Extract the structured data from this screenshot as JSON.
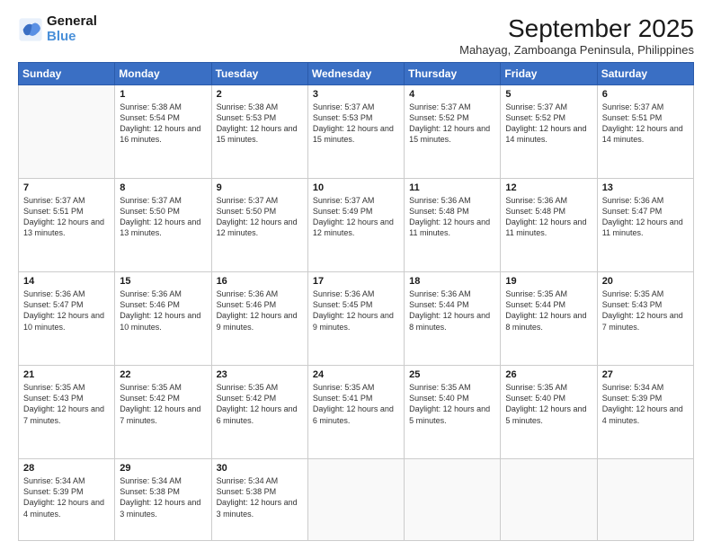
{
  "logo": {
    "line1": "General",
    "line2": "Blue"
  },
  "title": "September 2025",
  "location": "Mahayag, Zamboanga Peninsula, Philippines",
  "days": [
    "Sunday",
    "Monday",
    "Tuesday",
    "Wednesday",
    "Thursday",
    "Friday",
    "Saturday"
  ],
  "weeks": [
    [
      {
        "day": "",
        "info": ""
      },
      {
        "day": "1",
        "info": "Sunrise: 5:38 AM\nSunset: 5:54 PM\nDaylight: 12 hours\nand 16 minutes."
      },
      {
        "day": "2",
        "info": "Sunrise: 5:38 AM\nSunset: 5:53 PM\nDaylight: 12 hours\nand 15 minutes."
      },
      {
        "day": "3",
        "info": "Sunrise: 5:37 AM\nSunset: 5:53 PM\nDaylight: 12 hours\nand 15 minutes."
      },
      {
        "day": "4",
        "info": "Sunrise: 5:37 AM\nSunset: 5:52 PM\nDaylight: 12 hours\nand 15 minutes."
      },
      {
        "day": "5",
        "info": "Sunrise: 5:37 AM\nSunset: 5:52 PM\nDaylight: 12 hours\nand 14 minutes."
      },
      {
        "day": "6",
        "info": "Sunrise: 5:37 AM\nSunset: 5:51 PM\nDaylight: 12 hours\nand 14 minutes."
      }
    ],
    [
      {
        "day": "7",
        "info": "Sunrise: 5:37 AM\nSunset: 5:51 PM\nDaylight: 12 hours\nand 13 minutes."
      },
      {
        "day": "8",
        "info": "Sunrise: 5:37 AM\nSunset: 5:50 PM\nDaylight: 12 hours\nand 13 minutes."
      },
      {
        "day": "9",
        "info": "Sunrise: 5:37 AM\nSunset: 5:50 PM\nDaylight: 12 hours\nand 12 minutes."
      },
      {
        "day": "10",
        "info": "Sunrise: 5:37 AM\nSunset: 5:49 PM\nDaylight: 12 hours\nand 12 minutes."
      },
      {
        "day": "11",
        "info": "Sunrise: 5:36 AM\nSunset: 5:48 PM\nDaylight: 12 hours\nand 11 minutes."
      },
      {
        "day": "12",
        "info": "Sunrise: 5:36 AM\nSunset: 5:48 PM\nDaylight: 12 hours\nand 11 minutes."
      },
      {
        "day": "13",
        "info": "Sunrise: 5:36 AM\nSunset: 5:47 PM\nDaylight: 12 hours\nand 11 minutes."
      }
    ],
    [
      {
        "day": "14",
        "info": "Sunrise: 5:36 AM\nSunset: 5:47 PM\nDaylight: 12 hours\nand 10 minutes."
      },
      {
        "day": "15",
        "info": "Sunrise: 5:36 AM\nSunset: 5:46 PM\nDaylight: 12 hours\nand 10 minutes."
      },
      {
        "day": "16",
        "info": "Sunrise: 5:36 AM\nSunset: 5:46 PM\nDaylight: 12 hours\nand 9 minutes."
      },
      {
        "day": "17",
        "info": "Sunrise: 5:36 AM\nSunset: 5:45 PM\nDaylight: 12 hours\nand 9 minutes."
      },
      {
        "day": "18",
        "info": "Sunrise: 5:36 AM\nSunset: 5:44 PM\nDaylight: 12 hours\nand 8 minutes."
      },
      {
        "day": "19",
        "info": "Sunrise: 5:35 AM\nSunset: 5:44 PM\nDaylight: 12 hours\nand 8 minutes."
      },
      {
        "day": "20",
        "info": "Sunrise: 5:35 AM\nSunset: 5:43 PM\nDaylight: 12 hours\nand 7 minutes."
      }
    ],
    [
      {
        "day": "21",
        "info": "Sunrise: 5:35 AM\nSunset: 5:43 PM\nDaylight: 12 hours\nand 7 minutes."
      },
      {
        "day": "22",
        "info": "Sunrise: 5:35 AM\nSunset: 5:42 PM\nDaylight: 12 hours\nand 7 minutes."
      },
      {
        "day": "23",
        "info": "Sunrise: 5:35 AM\nSunset: 5:42 PM\nDaylight: 12 hours\nand 6 minutes."
      },
      {
        "day": "24",
        "info": "Sunrise: 5:35 AM\nSunset: 5:41 PM\nDaylight: 12 hours\nand 6 minutes."
      },
      {
        "day": "25",
        "info": "Sunrise: 5:35 AM\nSunset: 5:40 PM\nDaylight: 12 hours\nand 5 minutes."
      },
      {
        "day": "26",
        "info": "Sunrise: 5:35 AM\nSunset: 5:40 PM\nDaylight: 12 hours\nand 5 minutes."
      },
      {
        "day": "27",
        "info": "Sunrise: 5:34 AM\nSunset: 5:39 PM\nDaylight: 12 hours\nand 4 minutes."
      }
    ],
    [
      {
        "day": "28",
        "info": "Sunrise: 5:34 AM\nSunset: 5:39 PM\nDaylight: 12 hours\nand 4 minutes."
      },
      {
        "day": "29",
        "info": "Sunrise: 5:34 AM\nSunset: 5:38 PM\nDaylight: 12 hours\nand 3 minutes."
      },
      {
        "day": "30",
        "info": "Sunrise: 5:34 AM\nSunset: 5:38 PM\nDaylight: 12 hours\nand 3 minutes."
      },
      {
        "day": "",
        "info": ""
      },
      {
        "day": "",
        "info": ""
      },
      {
        "day": "",
        "info": ""
      },
      {
        "day": "",
        "info": ""
      }
    ]
  ]
}
